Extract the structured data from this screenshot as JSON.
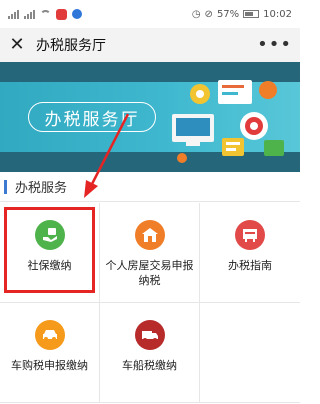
{
  "status_bar": {
    "battery": "57%",
    "time": "10:02"
  },
  "header": {
    "title": "办税服务厅",
    "more": "•••",
    "close": "✕"
  },
  "banner": {
    "text": "办税服务厅"
  },
  "section": {
    "title": "办税服务"
  },
  "services": [
    {
      "label": "社保缴纳",
      "icon": "social-security-icon",
      "color": "#4fb34b"
    },
    {
      "label": "个人房屋交易申报纳税",
      "icon": "house-icon",
      "color": "#f07d28"
    },
    {
      "label": "办税指南",
      "icon": "guide-icon",
      "color": "#e24a4a"
    },
    {
      "label": "车购税申报缴纳",
      "icon": "car-icon",
      "color": "#f59a1b"
    },
    {
      "label": "车船税缴纳",
      "icon": "truck-icon",
      "color": "#b72b2b"
    }
  ],
  "annotation": {
    "highlight_color": "#e52424"
  }
}
